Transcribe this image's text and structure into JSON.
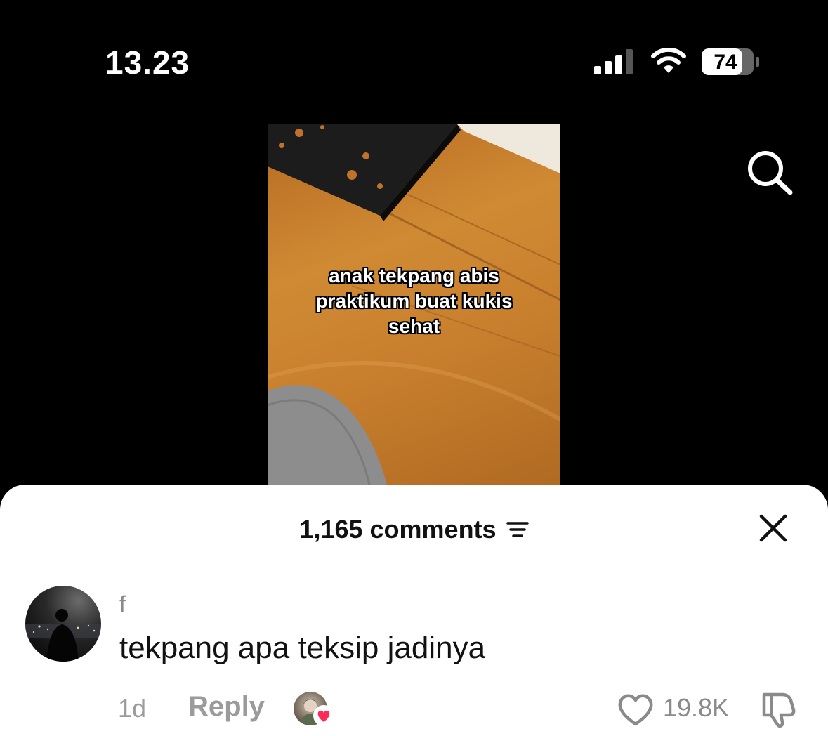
{
  "status_bar": {
    "time": "13.23",
    "battery": "74",
    "icons": [
      "signal-icon",
      "wifi-icon",
      "battery-icon"
    ]
  },
  "top_bar": {
    "icons": [
      "search-icon"
    ]
  },
  "video": {
    "caption": "anak tekpang abis\npraktikum buat kukis\nsehat"
  },
  "comments_sheet": {
    "count_label": "1,165 comments",
    "icons": [
      "filter-icon",
      "close-icon"
    ],
    "comments": [
      {
        "username": "f",
        "text": "tekpang apa teksip jadinya",
        "age": "1d",
        "reply_label": "Reply",
        "likes": "19.8K",
        "liked_by_creator": true,
        "icons": [
          "heart-outline-icon",
          "dislike-icon"
        ]
      }
    ]
  },
  "colors": {
    "background": "#000000",
    "sheet": "#ffffff",
    "muted_text": "#8a8a8a",
    "creator_heart": "#fe2c55"
  }
}
